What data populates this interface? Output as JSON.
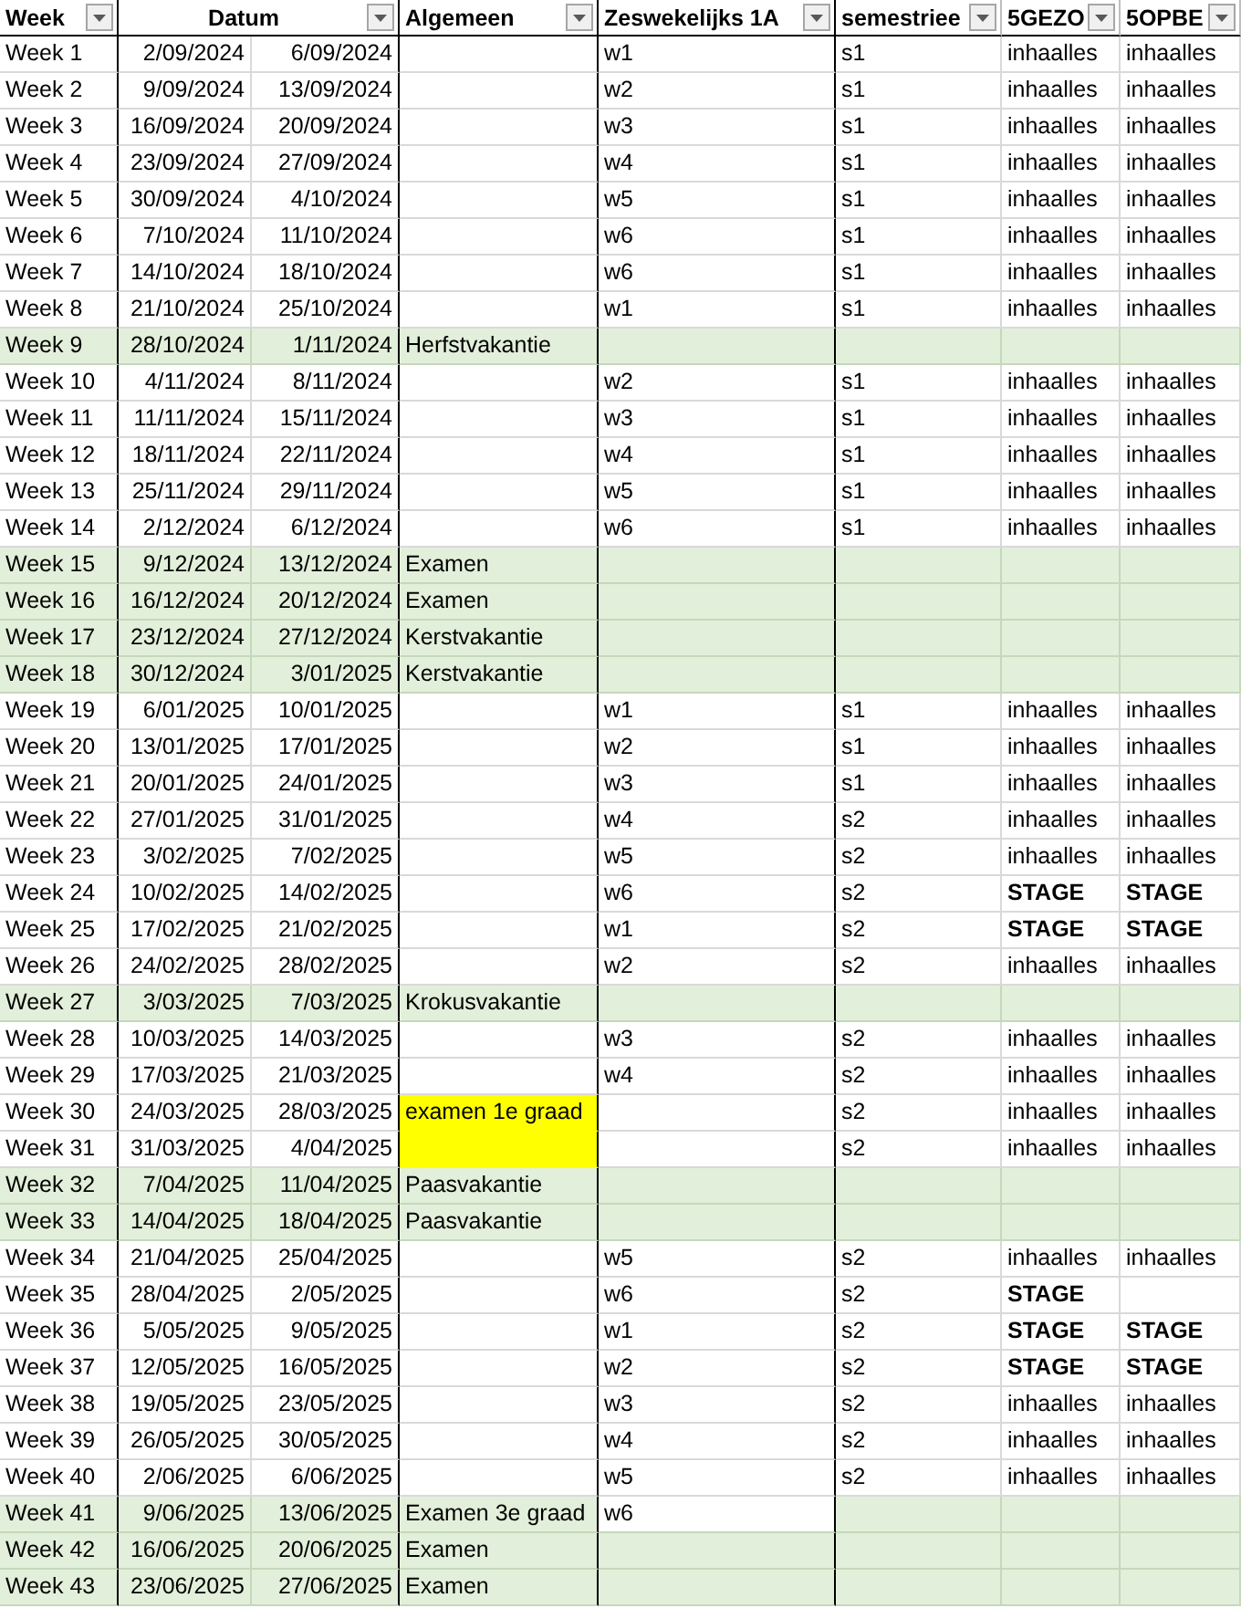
{
  "columns": [
    {
      "label": "Week"
    },
    {
      "label": "Datum"
    },
    {
      "label": "Algemeen"
    },
    {
      "label": "Zeswekelijks 1A"
    },
    {
      "label": "semestriee"
    },
    {
      "label": "5GEZO"
    },
    {
      "label": "5OPBE"
    }
  ],
  "rows": [
    {
      "kind": "lesson",
      "week": "Week 1",
      "start": "2/09/2024",
      "end": "6/09/2024",
      "zes": "w1",
      "sem": "s1",
      "gezo": {
        "text": "inhaalles",
        "bold": false
      },
      "opbe": {
        "text": "inhaalles",
        "bold": false
      }
    },
    {
      "kind": "lesson",
      "week": "Week 2",
      "start": "9/09/2024",
      "end": "13/09/2024",
      "zes": "w2",
      "sem": "s1",
      "gezo": {
        "text": "inhaalles",
        "bold": false
      },
      "opbe": {
        "text": "inhaalles",
        "bold": false
      }
    },
    {
      "kind": "lesson",
      "week": "Week 3",
      "start": "16/09/2024",
      "end": "20/09/2024",
      "zes": "w3",
      "sem": "s1",
      "gezo": {
        "text": "inhaalles",
        "bold": false
      },
      "opbe": {
        "text": "inhaalles",
        "bold": false
      }
    },
    {
      "kind": "lesson",
      "week": "Week 4",
      "start": "23/09/2024",
      "end": "27/09/2024",
      "zes": "w4",
      "sem": "s1",
      "gezo": {
        "text": "inhaalles",
        "bold": false
      },
      "opbe": {
        "text": "inhaalles",
        "bold": false
      }
    },
    {
      "kind": "lesson",
      "week": "Week 5",
      "start": "30/09/2024",
      "end": "4/10/2024",
      "zes": "w5",
      "sem": "s1",
      "gezo": {
        "text": "inhaalles",
        "bold": false
      },
      "opbe": {
        "text": "inhaalles",
        "bold": false
      }
    },
    {
      "kind": "lesson",
      "week": "Week 6",
      "start": "7/10/2024",
      "end": "11/10/2024",
      "zes": "w6",
      "sem": "s1",
      "gezo": {
        "text": "inhaalles",
        "bold": false
      },
      "opbe": {
        "text": "inhaalles",
        "bold": false
      }
    },
    {
      "kind": "lesson",
      "week": "Week 7",
      "start": "14/10/2024",
      "end": "18/10/2024",
      "zes": "w6",
      "sem": "s1",
      "gezo": {
        "text": "inhaalles",
        "bold": false
      },
      "opbe": {
        "text": "inhaalles",
        "bold": false
      }
    },
    {
      "kind": "lesson",
      "week": "Week 8",
      "start": "21/10/2024",
      "end": "25/10/2024",
      "zes": "w1",
      "sem": "s1",
      "gezo": {
        "text": "inhaalles",
        "bold": false
      },
      "opbe": {
        "text": "inhaalles",
        "bold": false
      }
    },
    {
      "kind": "holiday",
      "week": "Week 9",
      "start": "28/10/2024",
      "end": "1/11/2024",
      "algemeen": "Herfstvakantie"
    },
    {
      "kind": "lesson",
      "week": "Week 10",
      "start": "4/11/2024",
      "end": "8/11/2024",
      "zes": "w2",
      "sem": "s1",
      "gezo": {
        "text": "inhaalles",
        "bold": false
      },
      "opbe": {
        "text": "inhaalles",
        "bold": false
      }
    },
    {
      "kind": "lesson",
      "week": "Week 11",
      "start": "11/11/2024",
      "end": "15/11/2024",
      "zes": "w3",
      "sem": "s1",
      "gezo": {
        "text": "inhaalles",
        "bold": false
      },
      "opbe": {
        "text": "inhaalles",
        "bold": false
      }
    },
    {
      "kind": "lesson",
      "week": "Week 12",
      "start": "18/11/2024",
      "end": "22/11/2024",
      "zes": "w4",
      "sem": "s1",
      "gezo": {
        "text": "inhaalles",
        "bold": false
      },
      "opbe": {
        "text": "inhaalles",
        "bold": false
      }
    },
    {
      "kind": "lesson",
      "week": "Week 13",
      "start": "25/11/2024",
      "end": "29/11/2024",
      "zes": "w5",
      "sem": "s1",
      "gezo": {
        "text": "inhaalles",
        "bold": false
      },
      "opbe": {
        "text": "inhaalles",
        "bold": false
      }
    },
    {
      "kind": "lesson",
      "week": "Week 14",
      "start": "2/12/2024",
      "end": "6/12/2024",
      "zes": "w6",
      "sem": "s1",
      "gezo": {
        "text": "inhaalles",
        "bold": false
      },
      "opbe": {
        "text": "inhaalles",
        "bold": false
      }
    },
    {
      "kind": "holiday",
      "week": "Week 15",
      "start": "9/12/2024",
      "end": "13/12/2024",
      "algemeen": "Examen"
    },
    {
      "kind": "holiday",
      "week": "Week 16",
      "start": "16/12/2024",
      "end": "20/12/2024",
      "algemeen": "Examen"
    },
    {
      "kind": "holiday",
      "week": "Week 17",
      "start": "23/12/2024",
      "end": "27/12/2024",
      "algemeen": "Kerstvakantie"
    },
    {
      "kind": "holiday",
      "week": "Week 18",
      "start": "30/12/2024",
      "end": "3/01/2025",
      "algemeen": "Kerstvakantie"
    },
    {
      "kind": "lesson",
      "week": "Week 19",
      "start": "6/01/2025",
      "end": "10/01/2025",
      "zes": "w1",
      "sem": "s1",
      "gezo": {
        "text": "inhaalles",
        "bold": false
      },
      "opbe": {
        "text": "inhaalles",
        "bold": false
      }
    },
    {
      "kind": "lesson",
      "week": "Week 20",
      "start": "13/01/2025",
      "end": "17/01/2025",
      "zes": "w2",
      "sem": "s1",
      "gezo": {
        "text": "inhaalles",
        "bold": false
      },
      "opbe": {
        "text": "inhaalles",
        "bold": false
      }
    },
    {
      "kind": "lesson",
      "week": "Week 21",
      "start": "20/01/2025",
      "end": "24/01/2025",
      "zes": "w3",
      "sem": "s1",
      "gezo": {
        "text": "inhaalles",
        "bold": false
      },
      "opbe": {
        "text": "inhaalles",
        "bold": false
      }
    },
    {
      "kind": "lesson",
      "week": "Week 22",
      "start": "27/01/2025",
      "end": "31/01/2025",
      "zes": "w4",
      "sem": "s2",
      "gezo": {
        "text": "inhaalles",
        "bold": false
      },
      "opbe": {
        "text": "inhaalles",
        "bold": false
      }
    },
    {
      "kind": "lesson",
      "week": "Week 23",
      "start": "3/02/2025",
      "end": "7/02/2025",
      "zes": "w5",
      "sem": "s2",
      "gezo": {
        "text": "inhaalles",
        "bold": false
      },
      "opbe": {
        "text": "inhaalles",
        "bold": false
      }
    },
    {
      "kind": "lesson",
      "week": "Week 24",
      "start": "10/02/2025",
      "end": "14/02/2025",
      "zes": "w6",
      "sem": "s2",
      "gezo": {
        "text": "STAGE",
        "bold": true
      },
      "opbe": {
        "text": "STAGE",
        "bold": true
      }
    },
    {
      "kind": "lesson",
      "week": "Week 25",
      "start": "17/02/2025",
      "end": "21/02/2025",
      "zes": "w1",
      "sem": "s2",
      "gezo": {
        "text": "STAGE",
        "bold": true
      },
      "opbe": {
        "text": "STAGE",
        "bold": true
      }
    },
    {
      "kind": "lesson",
      "week": "Week 26",
      "start": "24/02/2025",
      "end": "28/02/2025",
      "zes": "w2",
      "sem": "s2",
      "gezo": {
        "text": "inhaalles",
        "bold": false
      },
      "opbe": {
        "text": "inhaalles",
        "bold": false
      }
    },
    {
      "kind": "holiday",
      "week": "Week 27",
      "start": "3/03/2025",
      "end": "7/03/2025",
      "algemeen": "Krokusvakantie"
    },
    {
      "kind": "lesson",
      "week": "Week 28",
      "start": "10/03/2025",
      "end": "14/03/2025",
      "zes": "w3",
      "sem": "s2",
      "gezo": {
        "text": "inhaalles",
        "bold": false
      },
      "opbe": {
        "text": "inhaalles",
        "bold": false
      }
    },
    {
      "kind": "lesson",
      "week": "Week 29",
      "start": "17/03/2025",
      "end": "21/03/2025",
      "zes": "w4",
      "sem": "s2",
      "gezo": {
        "text": "inhaalles",
        "bold": false
      },
      "opbe": {
        "text": "inhaalles",
        "bold": false
      }
    },
    {
      "kind": "lesson",
      "week": "Week 30",
      "start": "24/03/2025",
      "end": "28/03/2025",
      "algemeen": "examen 1e graad",
      "color": "#ffff00",
      "sem": "s2",
      "gezo": {
        "text": "inhaalles",
        "bold": false
      },
      "opbe": {
        "text": "inhaalles",
        "bold": false
      }
    },
    {
      "kind": "lesson",
      "week": "Week 31",
      "start": "31/03/2025",
      "end": "4/04/2025",
      "color": "#ffff00",
      "sem": "s2",
      "gezo": {
        "text": "inhaalles",
        "bold": false
      },
      "opbe": {
        "text": "inhaalles",
        "bold": false
      }
    },
    {
      "kind": "holiday",
      "week": "Week 32",
      "start": "7/04/2025",
      "end": "11/04/2025",
      "algemeen": "Paasvakantie"
    },
    {
      "kind": "holiday",
      "week": "Week 33",
      "start": "14/04/2025",
      "end": "18/04/2025",
      "algemeen": "Paasvakantie"
    },
    {
      "kind": "lesson",
      "week": "Week 34",
      "start": "21/04/2025",
      "end": "25/04/2025",
      "zes": "w5",
      "sem": "s2",
      "gezo": {
        "text": "inhaalles",
        "bold": false
      },
      "opbe": {
        "text": "inhaalles",
        "bold": false
      }
    },
    {
      "kind": "lesson",
      "week": "Week 35",
      "start": "28/04/2025",
      "end": "2/05/2025",
      "zes": "w6",
      "sem": "s2",
      "gezo": {
        "text": "STAGE",
        "bold": true
      }
    },
    {
      "kind": "lesson",
      "week": "Week 36",
      "start": "5/05/2025",
      "end": "9/05/2025",
      "zes": "w1",
      "sem": "s2",
      "gezo": {
        "text": "STAGE",
        "bold": true
      },
      "opbe": {
        "text": "STAGE",
        "bold": true
      }
    },
    {
      "kind": "lesson",
      "week": "Week 37",
      "start": "12/05/2025",
      "end": "16/05/2025",
      "zes": "w2",
      "sem": "s2",
      "gezo": {
        "text": "STAGE",
        "bold": true
      },
      "opbe": {
        "text": "STAGE",
        "bold": true
      }
    },
    {
      "kind": "lesson",
      "week": "Week 38",
      "start": "19/05/2025",
      "end": "23/05/2025",
      "zes": "w3",
      "sem": "s2",
      "gezo": {
        "text": "inhaalles",
        "bold": false
      },
      "opbe": {
        "text": "inhaalles",
        "bold": false
      }
    },
    {
      "kind": "lesson",
      "week": "Week 39",
      "start": "26/05/2025",
      "end": "30/05/2025",
      "zes": "w4",
      "sem": "s2",
      "gezo": {
        "text": "inhaalles",
        "bold": false
      },
      "opbe": {
        "text": "inhaalles",
        "bold": false
      }
    },
    {
      "kind": "lesson",
      "week": "Week 40",
      "start": "2/06/2025",
      "end": "6/06/2025",
      "zes": "w5",
      "sem": "s2",
      "gezo": {
        "text": "inhaalles",
        "bold": false
      },
      "opbe": {
        "text": "inhaalles",
        "bold": false
      }
    },
    {
      "kind": "holiday",
      "week": "Week 41",
      "start": "9/06/2025",
      "end": "13/06/2025",
      "algemeen": "Examen 3e graad",
      "zes": "w6"
    },
    {
      "kind": "holiday",
      "week": "Week 42",
      "start": "16/06/2025",
      "end": "20/06/2025",
      "algemeen": "Examen"
    },
    {
      "kind": "holiday",
      "week": "Week 43",
      "start": "23/06/2025",
      "end": "27/06/2025",
      "algemeen": "Examen"
    }
  ]
}
